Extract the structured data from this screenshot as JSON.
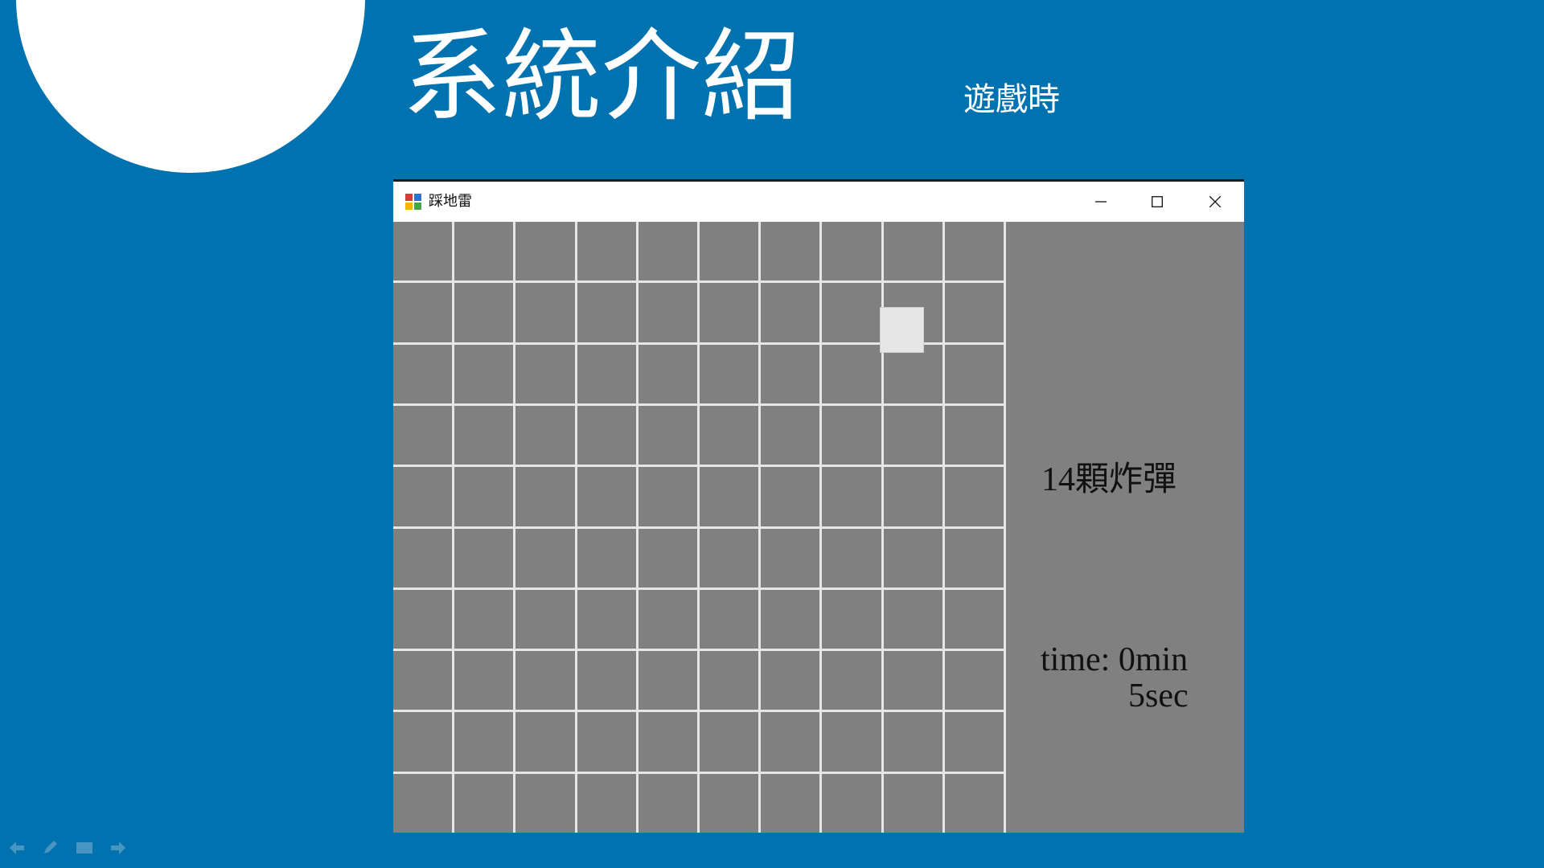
{
  "slide": {
    "title": "系統介紹",
    "subtitle": "遊戲時",
    "accent_color": "#FFC000",
    "background_color": "#0172B0",
    "quote_icon": "quote-mark-icon"
  },
  "window": {
    "title": "踩地雷",
    "app_icon": "minesweeper-app-icon",
    "controls": [
      "minimize-icon",
      "maximize-icon",
      "close-icon"
    ]
  },
  "game": {
    "rows": 10,
    "columns": 10,
    "cell_state": "unrevealed",
    "bomb_count_label": "14顆炸彈",
    "time_line_1": "time: 0min",
    "time_line_2": "5sec"
  },
  "presentation_nav": {
    "icons": [
      "previous-arrow-icon",
      "pen-icon",
      "slides-menu-icon",
      "next-arrow-icon"
    ]
  }
}
